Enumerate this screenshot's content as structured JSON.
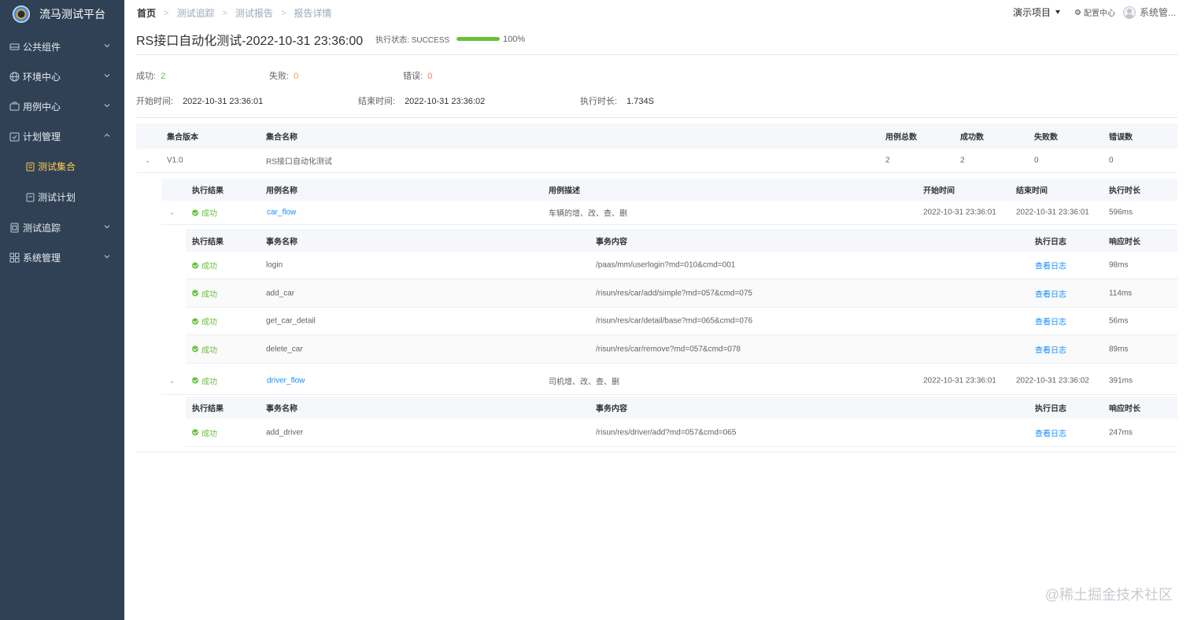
{
  "app": {
    "title": "流马测试平台"
  },
  "sidebar": {
    "items": [
      {
        "label": "公共组件",
        "icon": "component-icon"
      },
      {
        "label": "环境中心",
        "icon": "globe-icon"
      },
      {
        "label": "用例中心",
        "icon": "case-icon"
      },
      {
        "label": "计划管理",
        "icon": "calendar-icon",
        "expanded": true
      },
      {
        "label": "测试追踪",
        "icon": "tracking-icon"
      },
      {
        "label": "系统管理",
        "icon": "grid-icon"
      }
    ],
    "sub_items": [
      {
        "label": "测试集合",
        "active": true
      },
      {
        "label": "测试计划",
        "active": false
      }
    ]
  },
  "breadcrumb": [
    "首页",
    "测试追踪",
    "测试报告",
    "报告详情"
  ],
  "header": {
    "project": "演示项目",
    "config": "配置中心",
    "user": "系统管..."
  },
  "report": {
    "title": "RS接口自动化测试-2022-10-31 23:36:00",
    "status_label": "执行状态: SUCCESS",
    "progress": 100,
    "progress_text": "100%"
  },
  "stats": {
    "success_label": "成功:",
    "success": "2",
    "fail_label": "失败:",
    "fail": "0",
    "error_label": "错误:",
    "error": "0",
    "start_label": "开始时间:",
    "start": "2022-10-31 23:36:01",
    "end_label": "结束时间:",
    "end": "2022-10-31 23:36:02",
    "duration_label": "执行时长:",
    "duration": "1.734S"
  },
  "collection_table": {
    "headers": [
      "集合版本",
      "集合名称",
      "用例总数",
      "成功数",
      "失败数",
      "错误数"
    ],
    "row": [
      "V1.0",
      "RS接口自动化测试",
      "2",
      "2",
      "0",
      "0"
    ]
  },
  "case_table": {
    "headers": [
      "执行结果",
      "用例名称",
      "用例描述",
      "开始时间",
      "结束时间",
      "执行时长"
    ],
    "cases": [
      {
        "result": "成功",
        "name": "car_flow",
        "desc": "车辆的增、改、查、删",
        "start": "2022-10-31 23:36:01",
        "end": "2022-10-31 23:36:01",
        "duration": "596ms"
      },
      {
        "result": "成功",
        "name": "driver_flow",
        "desc": "司机增、改、查、删",
        "start": "2022-10-31 23:36:01",
        "end": "2022-10-31 23:36:02",
        "duration": "391ms"
      }
    ]
  },
  "transaction_table": {
    "headers": [
      "执行结果",
      "事务名称",
      "事务内容",
      "执行日志",
      "响应时长"
    ],
    "car_flow": [
      {
        "result": "成功",
        "name": "login",
        "content": "/paas/mm/userlogin?md=010&cmd=001",
        "log": "查看日志",
        "time": "98ms"
      },
      {
        "result": "成功",
        "name": "add_car",
        "content": "/risun/res/car/add/simple?md=057&cmd=075",
        "log": "查看日志",
        "time": "114ms"
      },
      {
        "result": "成功",
        "name": "get_car_detail",
        "content": "/risun/res/car/detail/base?md=065&cmd=076",
        "log": "查看日志",
        "time": "56ms"
      },
      {
        "result": "成功",
        "name": "delete_car",
        "content": "/risun/res/car/remove?md=057&cmd=078",
        "log": "查看日志",
        "time": "89ms"
      }
    ],
    "driver_flow": [
      {
        "result": "成功",
        "name": "add_driver",
        "content": "/risun/res/driver/add?md=057&cmd=065",
        "log": "查看日志",
        "time": "247ms"
      }
    ]
  },
  "watermark": "@稀土掘金技术社区",
  "colors": {
    "sidebar_bg": "#304156",
    "success": "#67c23a",
    "link": "#1890ff",
    "active_menu": "#ffd04b",
    "error": "#f56c6c",
    "fail": "#e6a23c"
  }
}
